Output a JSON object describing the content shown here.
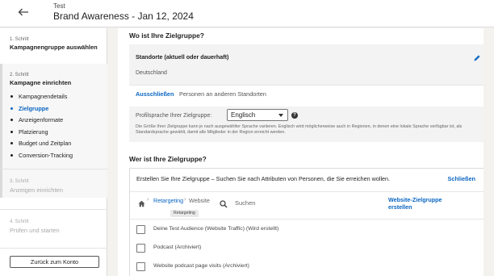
{
  "header": {
    "back_label": "back",
    "subtitle": "Test",
    "title": "Brand Awareness - Jan 12, 2024"
  },
  "sidebar": {
    "steps": [
      {
        "num": "1. Schritt",
        "title": "Kampagnengruppe auswählen"
      },
      {
        "num": "2. Schritt",
        "title": "Kampagne einrichten"
      },
      {
        "num": "3. Schritt",
        "title": "Anzeigen einrichten"
      },
      {
        "num": "4. Schritt",
        "title": "Prüfen und starten"
      }
    ],
    "substeps": [
      {
        "label": "Kampagnendetails"
      },
      {
        "label": "Zielgruppe"
      },
      {
        "label": "Anzeigenformate"
      },
      {
        "label": "Platzierung"
      },
      {
        "label": "Budget und Zeitplan"
      },
      {
        "label": "Conversion-Tracking"
      }
    ],
    "back_button": "Zurück zum Konto"
  },
  "location": {
    "heading": "Wo ist Ihre Zielgruppe?",
    "label": "Standorte (aktuell oder dauerhaft)",
    "value": "Deutschland",
    "exclude_link": "Ausschließen",
    "exclude_other": "Personen an anderen Standorten"
  },
  "language": {
    "label": "Profilsprache Ihrer Zielgruppe:",
    "selected": "Englisch",
    "help": "?",
    "note": "Die Größe Ihrer Zielgruppe kann je nach ausgewählter Sprache variieren. Englisch wird möglicherweise auch in Regionen, in denen eine lokale Sprache verfügbar ist, als Standardsprache gewählt, damit alle Mitglieder in der Region erreicht werden."
  },
  "audience": {
    "heading": "Wer ist Ihre Zielgruppe?",
    "description": "Erstellen Sie Ihre Zielgruppe – Suchen Sie nach Attributen von Personen, die Sie erreichen wollen.",
    "close": "Schließen",
    "breadcrumb": {
      "retargeting": "Retargeting",
      "website": "Website"
    },
    "tooltip": "Retargeting",
    "search_placeholder": "Suchen",
    "website_link": "Website-Zielgruppe erstellen",
    "rows": [
      {
        "label": "Deine Test Audience (Website Traffic)  (Wird erstellt)"
      },
      {
        "label": "Podcast  (Archiviert)"
      },
      {
        "label": "Website podcast page visits  (Archiviert)"
      }
    ]
  },
  "colors": {
    "accent": "#0a66c2",
    "background": "#f3f2ef"
  }
}
